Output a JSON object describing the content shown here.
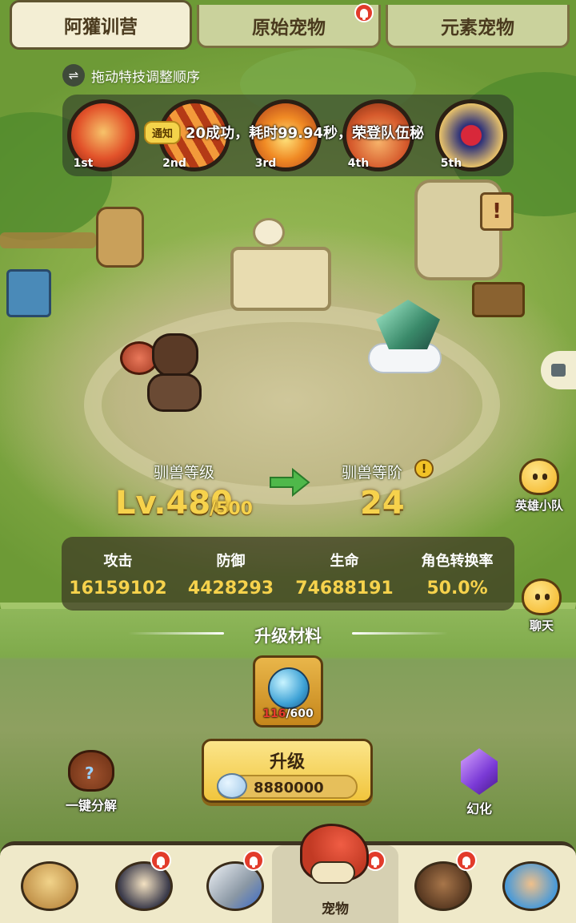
{
  "tabs": [
    {
      "label": "阿獾训营",
      "active": true,
      "alert": false
    },
    {
      "label": "原始宠物",
      "active": false,
      "alert": true
    },
    {
      "label": "元素宠物",
      "active": false,
      "alert": false
    }
  ],
  "hint": {
    "icon": "swap-arrows-icon",
    "text": "拖动特技调整顺序"
  },
  "skills": [
    {
      "rank": "1st",
      "icon": "fire-spiral-skill-icon",
      "color": "#e2522a"
    },
    {
      "rank": "2nd",
      "icon": "fire-claw-skill-icon",
      "color": "#d84c24"
    },
    {
      "rank": "3rd",
      "icon": "flame-burst-skill-icon",
      "color": "#e56a1c"
    },
    {
      "rank": "4th",
      "icon": "paw-skill-icon",
      "color": "#d65a2c"
    },
    {
      "rank": "5th",
      "icon": "heart-shield-skill-icon",
      "color": "#3a3f9a"
    }
  ],
  "notice": {
    "tag": "通知",
    "text": "20成功，耗时99.94秒，荣登队伍秘"
  },
  "side": {
    "team_label": "英雄小队",
    "chat_label": "聊天"
  },
  "level": {
    "label": "驯兽等级",
    "value": "Lv.480",
    "max": "/500",
    "stage_label": "驯兽等阶",
    "stage_value": "24",
    "info_icon": "!"
  },
  "stats": [
    {
      "label": "攻击",
      "value": "16159102"
    },
    {
      "label": "防御",
      "value": "4428293"
    },
    {
      "label": "生命",
      "value": "74688191"
    },
    {
      "label": "角色转换率",
      "value": "50.0%"
    }
  ],
  "materials": {
    "title": "升级材料",
    "item_icon": "blue-potion-bag-icon",
    "have": "116",
    "need": "/600",
    "have_color": "#e83a2e"
  },
  "upgrade": {
    "label": "升级",
    "cost": "8880000",
    "cost_icon": "stone-currency-icon"
  },
  "actions": {
    "decompose_label": "一键分解",
    "transform_label": "幻化"
  },
  "nav": [
    {
      "icon": "caveman-hero-icon",
      "label": "",
      "active": false,
      "alert": false
    },
    {
      "icon": "tribesman-hero-icon",
      "label": "",
      "active": false,
      "alert": true
    },
    {
      "icon": "sword-stone-icon",
      "label": "",
      "active": false,
      "alert": true
    },
    {
      "icon": "pet-dino-icon",
      "label": "宠物",
      "active": true,
      "alert": true
    },
    {
      "icon": "bear-totem-icon",
      "label": "",
      "active": false,
      "alert": true
    },
    {
      "icon": "tribe-totem-icon",
      "label": "",
      "active": false,
      "alert": false
    }
  ],
  "colors": {
    "accent_gold": "#f6d24c",
    "alert_red": "#e23b2b",
    "panel_dark": "#3c3723"
  }
}
